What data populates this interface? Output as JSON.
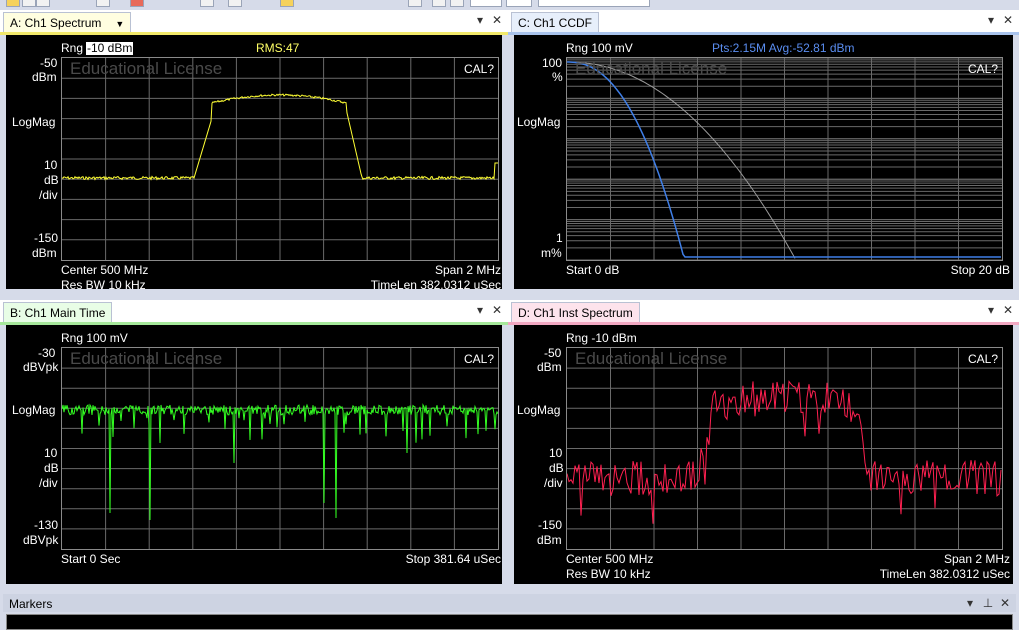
{
  "panes": {
    "a": {
      "tab_label": "A: Ch1 Spectrum",
      "tab_color": "#fffee0",
      "underline_color": "#f2e96a",
      "trace_color": "#ffff33",
      "rng_label": "Rng",
      "rng_value": "-10 dBm",
      "rms": "RMS:47",
      "watermark": "Educational License",
      "cal": "CAL?",
      "y_top": "-50",
      "y_top_unit": "dBm",
      "y_mode": "LogMag",
      "y_div_value": "10",
      "y_div_unit": "dB",
      "y_div_suffix": "/div",
      "y_bottom": "-150",
      "y_bottom_unit": "dBm",
      "footer_left_1": "Center 500 MHz",
      "footer_left_2": "Res BW 10 kHz",
      "footer_right_1": "Span 2 MHz",
      "footer_right_2": "TimeLen 382.0312 uSec"
    },
    "b": {
      "tab_label": "B: Ch1 Main Time",
      "tab_color": "#e8fde6",
      "underline_color": "#a6e89b",
      "trace_color": "#33ff22",
      "rng": "Rng 100 mV",
      "watermark": "Educational License",
      "cal": "CAL?",
      "y_top": "-30",
      "y_top_unit": "dBVpk",
      "y_mode": "LogMag",
      "y_div_value": "10",
      "y_div_unit": "dB",
      "y_div_suffix": "/div",
      "y_bottom": "-130",
      "y_bottom_unit": "dBVpk",
      "footer_left_1": "Start 0  Sec",
      "footer_right_1": "Stop 381.64 uSec"
    },
    "c": {
      "tab_label": "C: Ch1 CCDF",
      "tab_color": "#e7effb",
      "underline_color": "#a9c3ec",
      "trace_color": "#3f7fe8",
      "rng": "Rng 100 mV",
      "info": "Pts:2.15M Avg:-52.81 dBm",
      "info_color": "#5a8df0",
      "watermark": "Educational License",
      "cal": "CAL?",
      "y_top": "100",
      "y_top_unit": "%",
      "y_mode": "LogMag",
      "y_bottom": "1",
      "y_bottom_unit": "m%",
      "footer_left_1": "Start 0 dB",
      "footer_right_1": "Stop 20 dB"
    },
    "d": {
      "tab_label": "D: Ch1 Inst Spectrum",
      "tab_color": "#fde3ec",
      "underline_color": "#f2a8c2",
      "trace_color": "#ff2050",
      "rng": "Rng -10 dBm",
      "watermark": "Educational License",
      "cal": "CAL?",
      "y_top": "-50",
      "y_top_unit": "dBm",
      "y_mode": "LogMag",
      "y_div_value": "10",
      "y_div_unit": "dB",
      "y_div_suffix": "/div",
      "y_bottom": "-150",
      "y_bottom_unit": "dBm",
      "footer_left_1": "Center 500 MHz",
      "footer_left_2": "Res BW 10 kHz",
      "footer_right_1": "Span 2 MHz",
      "footer_right_2": "TimeLen 382.0312 uSec"
    }
  },
  "pane_controls": {
    "pin": "▾",
    "close": "✕"
  },
  "markers": {
    "title": "Markers",
    "pin": "▾",
    "dock": "⊥",
    "close": "✕"
  }
}
